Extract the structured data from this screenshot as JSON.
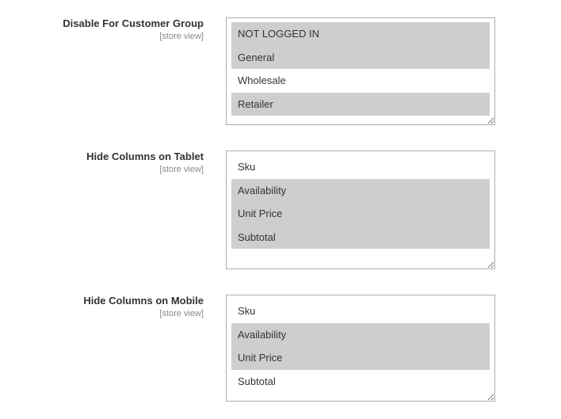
{
  "fields": {
    "disable_customer_group": {
      "label": "Disable For Customer Group",
      "scope": "[store view]",
      "options": [
        {
          "label": "NOT LOGGED IN",
          "selected": true
        },
        {
          "label": "General",
          "selected": true
        },
        {
          "label": "Wholesale",
          "selected": false
        },
        {
          "label": "Retailer",
          "selected": true
        }
      ],
      "rows": 4
    },
    "hide_columns_tablet": {
      "label": "Hide Columns on Tablet",
      "scope": "[store view]",
      "options": [
        {
          "label": "Sku",
          "selected": false
        },
        {
          "label": "Availability",
          "selected": true
        },
        {
          "label": "Unit Price",
          "selected": true
        },
        {
          "label": "Subtotal",
          "selected": true
        }
      ],
      "rows": 5
    },
    "hide_columns_mobile": {
      "label": "Hide Columns on Mobile",
      "scope": "[store view]",
      "options": [
        {
          "label": "Sku",
          "selected": false
        },
        {
          "label": "Availability",
          "selected": true
        },
        {
          "label": "Unit Price",
          "selected": true
        },
        {
          "label": "Subtotal",
          "selected": false
        }
      ],
      "rows": 4
    }
  }
}
